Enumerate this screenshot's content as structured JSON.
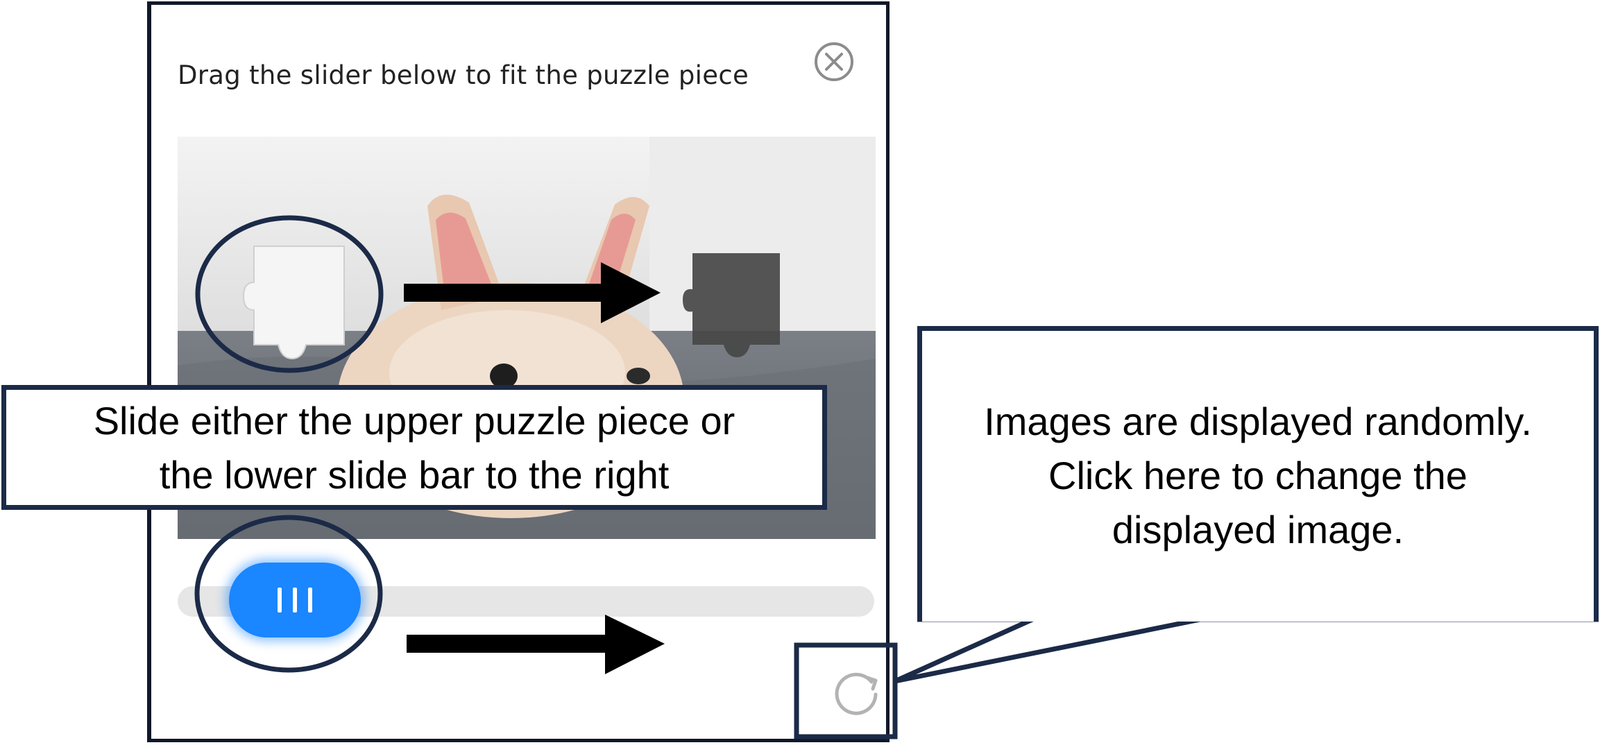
{
  "dialog": {
    "title": "Drag the slider below to fit the puzzle piece",
    "close_icon": "close-circle-icon",
    "refresh_icon": "refresh-icon",
    "slider_handle_icon": "grip-lines-icon",
    "accent_color": "#1a86ff"
  },
  "annotations": {
    "slide_instruction": {
      "line1": "Slide either the upper puzzle piece or",
      "line2": "the lower slide bar to the right"
    },
    "images_note": {
      "line1": "Images are displayed randomly.",
      "line2": "Click here to change the",
      "line3": "displayed image."
    },
    "border_color": "#1b2a47"
  }
}
